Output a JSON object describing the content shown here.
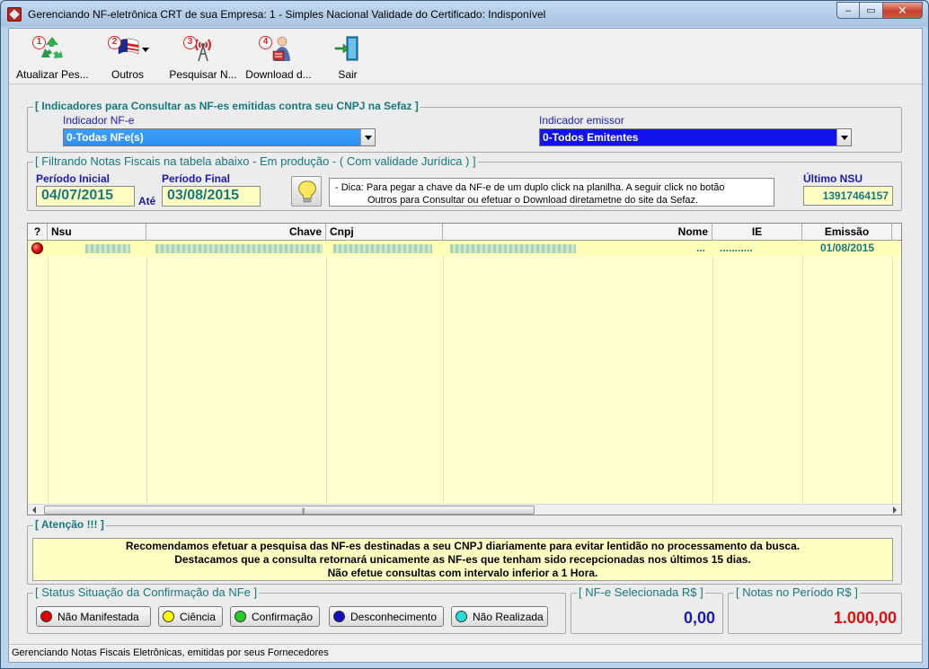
{
  "window": {
    "title": "Gerenciando NF-eletrônica CRT de sua Empresa: 1 - Simples Nacional Validade do Certificado: Indisponível",
    "minimize": "–",
    "maximize": "▭",
    "close": "✕"
  },
  "toolbar": {
    "items": [
      {
        "num": "1",
        "label": "Atualizar Pes...",
        "icon": "recycle-icon"
      },
      {
        "num": "2",
        "label": "Outros",
        "icon": "flag-icon"
      },
      {
        "num": "3",
        "label": "Pesquisar N...",
        "icon": "antenna-icon"
      },
      {
        "num": "4",
        "label": "Download d...",
        "icon": "download-person-icon"
      },
      {
        "num": "",
        "label": "Sair",
        "icon": "exit-door-icon"
      }
    ]
  },
  "indicators": {
    "legend": "[ Indicadores para Consultar as NF-es emitidas contra seu CNPJ na Sefaz ]",
    "nfe_label": "Indicador NF-e",
    "nfe_value": "0-Todas NFe(s)",
    "emit_label": "Indicador emissor",
    "emit_value": "0-Todos Emitentes"
  },
  "filter": {
    "legend": "[ Filtrando Notas Fiscais na tabela abaixo - Em produção - ( Com validade Jurídica ) ]",
    "start_label": "Período Inicial",
    "start_value": "04/07/2015",
    "until_label": "Até",
    "end_label": "Período Final",
    "end_value": "03/08/2015",
    "tip_line1": "- Dica: Para pegar a chave da NF-e de um duplo click na planilha.  A seguir click no botão",
    "tip_line2": "Outros para Consultar ou efetuar o Download  diretametne do site da Sefaz.",
    "nsu_label": "Último NSU",
    "nsu_value": "13917464157"
  },
  "grid": {
    "headers": [
      "?",
      "Nsu",
      "Chave",
      "Cnpj",
      "Nome",
      "IE",
      "Emissão"
    ],
    "rows": [
      {
        "nome_suffix": "...",
        "ie_suffix": "...........",
        "emissao": "01/08/2015"
      }
    ]
  },
  "attention": {
    "legend": "[ Atenção !!! ]",
    "line1": "Recomendamos efetuar a pesquisa das NF-es destinadas a seu CNPJ diariamente para evitar lentidão no processamento da busca.",
    "line2": "Destacamos que a consulta retornará unicamente as NF-es que tenham sido recepcionadas nos últimos 15 dias.",
    "line3": "Não efetue consultas com intervalo inferior a 1 Hora."
  },
  "status": {
    "legend": "[ Status Situação da Confirmação da NFe ]",
    "buttons": [
      {
        "label": "Não Manifestada",
        "color": "#e00000"
      },
      {
        "label": "Ciência",
        "color": "#ffff00"
      },
      {
        "label": "Confirmação",
        "color": "#22cc22"
      },
      {
        "label": "Desconhecimento",
        "color": "#1010c0"
      },
      {
        "label": "Não Realizada",
        "color": "#22dddd"
      }
    ]
  },
  "selected": {
    "legend": "[ NF-e Selecionada R$ ]",
    "value": "0,00",
    "color": "#1a1ab8"
  },
  "period": {
    "legend": "[ Notas no Período R$ ]",
    "value": "1.000,00",
    "color": "#e01010"
  },
  "statusbar": {
    "text": "Gerenciando Notas Fiscais Eletrônicas, emitidas por seus Fornecedores"
  }
}
